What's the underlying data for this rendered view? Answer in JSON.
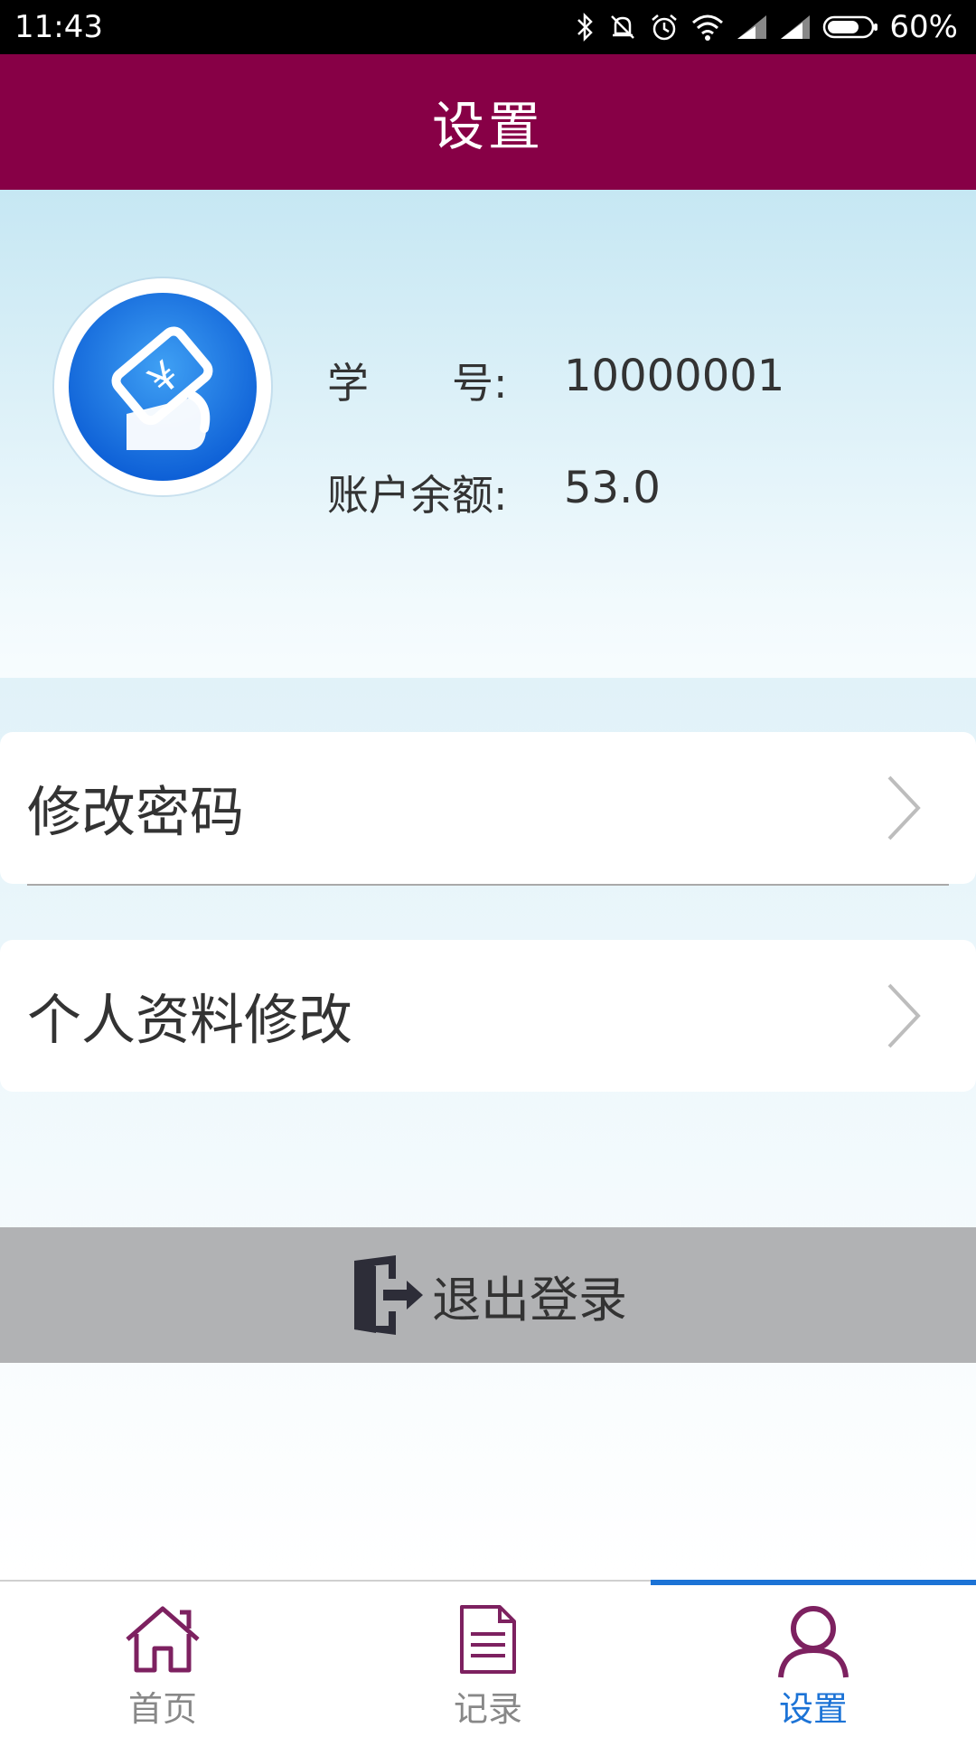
{
  "status_bar": {
    "time": "11:43",
    "battery": "60%"
  },
  "header": {
    "title": "设置"
  },
  "profile": {
    "id_label": "学　　号:",
    "id_value": "10000001",
    "balance_label": "账户余额:",
    "balance_value": "53.0"
  },
  "menu": {
    "items": [
      {
        "label": "修改密码"
      },
      {
        "label": "个人资料修改"
      }
    ]
  },
  "logout": {
    "label": "退出登录"
  },
  "tabs": [
    {
      "label": "首页"
    },
    {
      "label": "记录"
    },
    {
      "label": "设置",
      "active": true
    }
  ],
  "colors": {
    "header": "#870046",
    "active_tab": "#1c73d6",
    "logout_bar": "#b1b2b4"
  }
}
